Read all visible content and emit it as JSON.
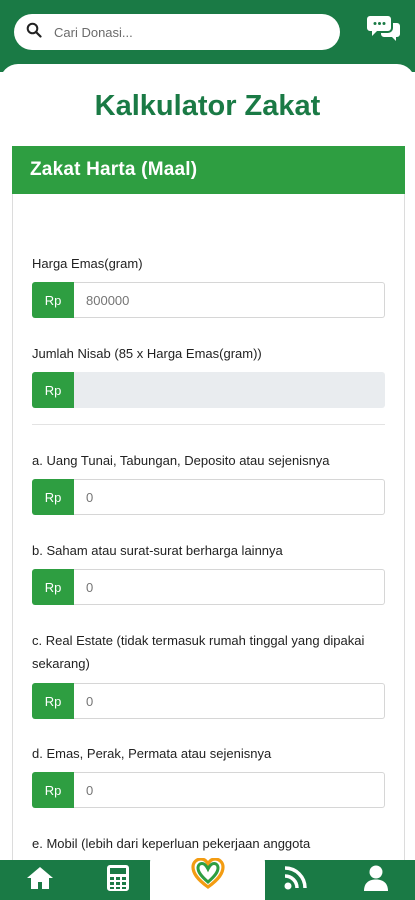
{
  "search": {
    "placeholder": "Cari Donasi..."
  },
  "page": {
    "title": "Kalkulator Zakat"
  },
  "card": {
    "title": "Zakat Harta (Maal)"
  },
  "currency_label": "Rp",
  "fields": [
    {
      "label": "Harga Emas(gram)",
      "value": "",
      "placeholder": "800000"
    },
    {
      "label": "Jumlah Nisab (85 x Harga Emas(gram))",
      "value": "",
      "placeholder": ""
    },
    {
      "label": "a. Uang Tunai, Tabungan, Deposito atau sejenisnya",
      "value": "",
      "placeholder": "0"
    },
    {
      "label": "b. Saham atau surat-surat berharga lainnya",
      "value": "",
      "placeholder": "0"
    },
    {
      "label": "c. Real Estate (tidak termasuk rumah tinggal yang dipakai sekarang)",
      "value": "",
      "placeholder": "0"
    },
    {
      "label": "d. Emas, Perak, Permata atau sejenisnya",
      "value": "",
      "placeholder": "0"
    },
    {
      "label": "e. Mobil (lebih dari keperluan pekerjaan anggota",
      "value": "",
      "placeholder": ""
    }
  ],
  "nav": {
    "items": [
      "home-icon",
      "calculator-icon",
      "heart-logo-icon",
      "broadcast-icon",
      "user-icon"
    ]
  },
  "colors": {
    "primary": "#1a7a45",
    "accent": "#2e9e41",
    "logo_orange": "#f39c12"
  }
}
